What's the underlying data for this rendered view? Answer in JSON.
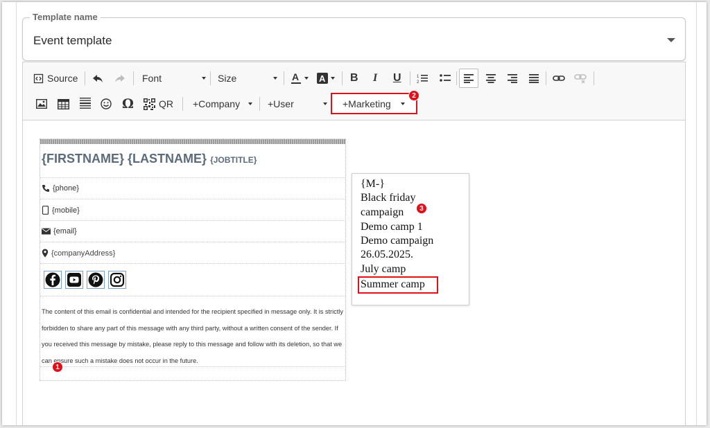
{
  "template_field": {
    "legend": "Template name",
    "value": "Event template"
  },
  "toolbar": {
    "source_label": "Source",
    "font_label": "Font",
    "size_label": "Size",
    "qr_label": "QR",
    "company_label": "+Company",
    "user_label": "+User",
    "marketing_label": "+Marketing"
  },
  "signature": {
    "firstname": "{FIRSTNAME}",
    "lastname": "{LASTNAME}",
    "jobtitle": "{JOBTITLE}",
    "phone": "{phone}",
    "mobile": "{mobile}",
    "email": "{email}",
    "address": "{companyAddress}",
    "disclaimer": "The content of this email is confidential and intended for the recipient specified in message only. It is strictly forbidden to share any part of this message with any third party, without a written consent of the sender. If you received this message by mistake, please reply to this message and follow with its deletion, so that we can ensure such a mistake does not occur in the future.",
    "social_icons": [
      "facebook-icon",
      "youtube-icon",
      "pinterest-icon",
      "instagram-icon"
    ]
  },
  "marketing_dropdown": {
    "items": [
      "{M-}",
      "Black friday",
      "campaign",
      "Demo camp 1",
      "Demo campaign",
      "26.05.2025.",
      "July camp",
      "Summer camp"
    ],
    "highlighted": "Summer camp"
  },
  "markers": [
    "1",
    "2",
    "3"
  ],
  "colors": {
    "accent_red": "#e0101a",
    "signature_name": "#5b6b7c"
  }
}
